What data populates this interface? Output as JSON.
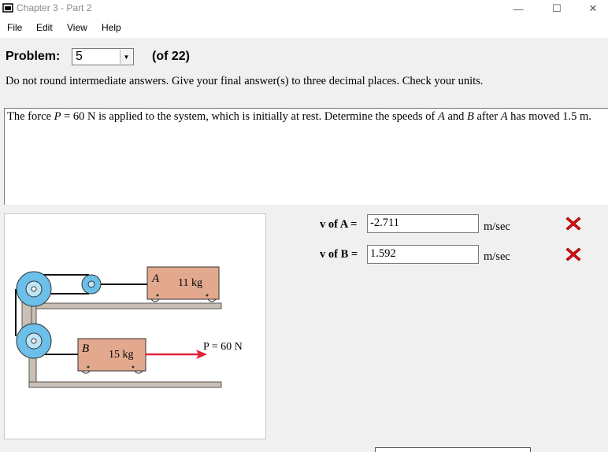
{
  "window": {
    "title": "Chapter 3 - Part 2",
    "minimize_glyph": "—",
    "maximize_glyph": "☐",
    "close_glyph": "✕"
  },
  "menu": [
    "File",
    "Edit",
    "View",
    "Help"
  ],
  "problem": {
    "label": "Problem:",
    "selected": "5",
    "of_text": "(of 22)"
  },
  "instructions": "Do not round intermediate answers.  Give your final answer(s) to three decimal places.  Check your units.",
  "statement": {
    "t1": "The force ",
    "p_var": "P",
    "t2": " = 60 N is applied to the system, which is initially at rest. Determine the speeds of ",
    "a_var": "A",
    "t3": " and ",
    "b_var": "B",
    "t4": " after ",
    "a_var2": "A",
    "t5": " has moved 1.5 m."
  },
  "figure": {
    "block_a_letter": "A",
    "block_a_mass": "11 kg",
    "block_b_letter": "B",
    "block_b_mass": "15 kg",
    "force_label": "P = 60 N",
    "colors": {
      "block": "#e3a98f",
      "pulley": "#6bbfe8",
      "frame": "#c9bfb4",
      "force_arrow": "#e8203a"
    }
  },
  "answers": [
    {
      "label": "v of A =",
      "value": "-2.711",
      "unit": "m/sec",
      "status": "incorrect"
    },
    {
      "label": "v of B =",
      "value": "1.592",
      "unit": "m/sec",
      "status": "incorrect"
    }
  ],
  "colors": {
    "incorrect_mark": "#e01010"
  }
}
